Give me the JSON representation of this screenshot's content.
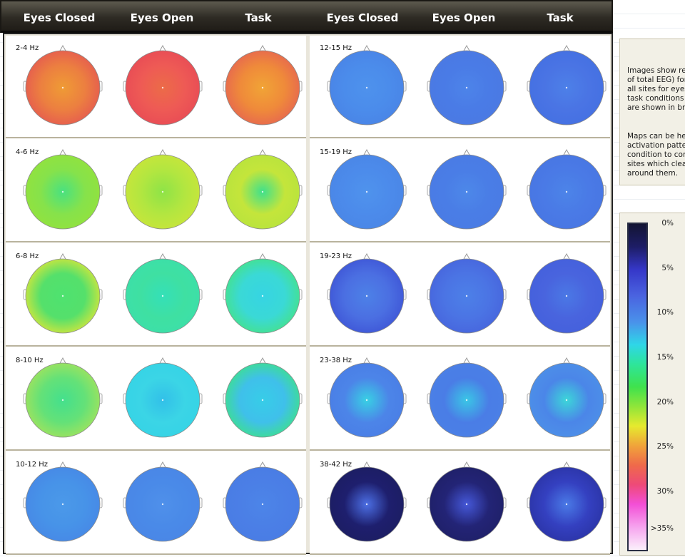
{
  "header": {
    "left": [
      "Eyes Closed",
      "Eyes Open",
      "Task"
    ],
    "right": [
      "Eyes Closed",
      "Eyes Open",
      "Task"
    ]
  },
  "bands": {
    "left": [
      {
        "label": "2-4 Hz",
        "maps": [
          [
            "#ec7f40",
            "#ef9b35",
            "#e55a50"
          ],
          [
            "#ee5a55",
            "#ec6b48",
            "#e84b55"
          ],
          [
            "#ef8a3a",
            "#f1a436",
            "#e66650"
          ]
        ]
      },
      {
        "label": "4-6 Hz",
        "maps": [
          [
            "#86e24b",
            "#49e180",
            "#93e23d"
          ],
          [
            "#b3e640",
            "#8ee347",
            "#c9e53a"
          ],
          [
            "#c4e53b",
            "#3fe08c",
            "#b8e43d"
          ]
        ]
      },
      {
        "label": "6-8 Hz",
        "maps": [
          [
            "#55e06b",
            "#4ee270",
            "#d7e63a"
          ],
          [
            "#3fe0a2",
            "#34e0b8",
            "#3cdfa9"
          ],
          [
            "#3ad9d6",
            "#36d4e3",
            "#45e28a"
          ]
        ]
      },
      {
        "label": "8-10 Hz",
        "maps": [
          [
            "#64e178",
            "#44e08d",
            "#a3e35c"
          ],
          [
            "#3bd5e6",
            "#32c0e8",
            "#35d3e5"
          ],
          [
            "#3fc0ea",
            "#37cde8",
            "#3ee08d"
          ]
        ]
      },
      {
        "label": "10-12 Hz",
        "maps": [
          [
            "#4793e8",
            "#4b99e9",
            "#4788e6"
          ],
          [
            "#4a8ae8",
            "#4f90ea",
            "#4a86e6"
          ],
          [
            "#4b7fe6",
            "#4c85e8",
            "#4a7ce4"
          ]
        ]
      }
    ],
    "right": [
      {
        "label": "12-15 Hz",
        "maps": [
          [
            "#4b8ceb",
            "#4e92ec",
            "#4a84e6"
          ],
          [
            "#4a7be6",
            "#4d84e9",
            "#4b7ae3"
          ],
          [
            "#4a74e4",
            "#4d80e8",
            "#4470e2"
          ]
        ]
      },
      {
        "label": "15-19 Hz",
        "maps": [
          [
            "#4c8beb",
            "#4f93ec",
            "#4a86e6"
          ],
          [
            "#4a7de6",
            "#4d88e9",
            "#4a7ce4"
          ],
          [
            "#4a7ae6",
            "#4c84e8",
            "#4876e3"
          ]
        ]
      },
      {
        "label": "19-23 Hz",
        "maps": [
          [
            "#4b6fe2",
            "#4d81e7",
            "#3e55d6"
          ],
          [
            "#4b74e4",
            "#4c80e8",
            "#4765dd"
          ],
          [
            "#4964de",
            "#4a78e5",
            "#4460dc"
          ]
        ]
      },
      {
        "label": "23-38 Hz",
        "maps": [
          [
            "#4c85e8",
            "#38d0e4",
            "#4a7ee6"
          ],
          [
            "#4a7de6",
            "#3ac6e6",
            "#4b80e6"
          ],
          [
            "#4b86e8",
            "#3cd6d9",
            "#4d90e8"
          ]
        ]
      },
      {
        "label": "38-42 Hz",
        "maps": [
          [
            "#1e1f6e",
            "#4c6fe4",
            "#1c1d62"
          ],
          [
            "#232476",
            "#4558d8",
            "#1f2068"
          ],
          [
            "#3440c0",
            "#4a7ae6",
            "#2b34a6"
          ]
        ]
      }
    ]
  },
  "info": {
    "para1": [
      "Images show re",
      "of total EEG) for",
      "all sites for eyes",
      "task conditions",
      "are shown in bri"
    ],
    "para2": [
      "Maps can be he",
      "activation patte",
      "condition to con",
      "sites which clea",
      "around them."
    ]
  },
  "legend": {
    "ticks": [
      "0%",
      "5%",
      "10%",
      "15%",
      "20%",
      "25%",
      "30%",
      ">35%"
    ]
  }
}
